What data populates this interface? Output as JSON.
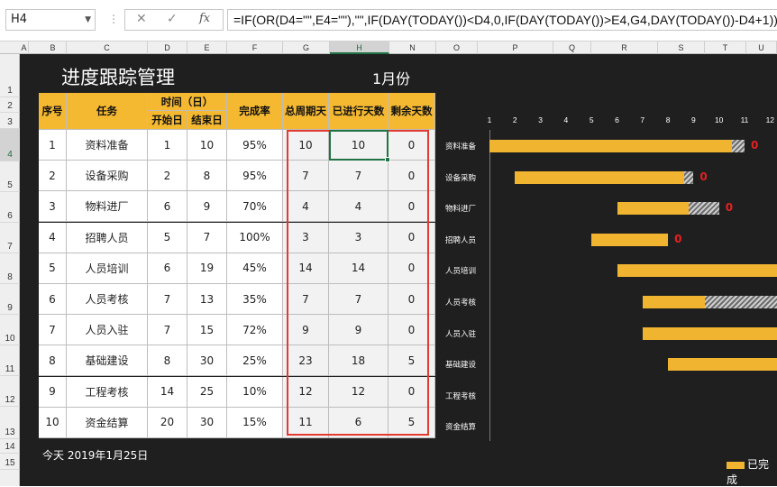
{
  "formula_bar": {
    "cell_ref": "H4",
    "cancel_symbol": "✕",
    "enter_symbol": "✓",
    "fx_label": "fx",
    "formula": "=IF(OR(D4=\"\",E4=\"\"),\"\",IF(DAY(TODAY())<D4,0,IF(DAY(TODAY())>E4,G4,DAY(TODAY())-D4+1)))"
  },
  "columns": [
    "A",
    "B",
    "C",
    "D",
    "E",
    "F",
    "G",
    "H",
    "N",
    "O",
    "P",
    "Q",
    "R",
    "S",
    "T",
    "U"
  ],
  "rows": [
    "1",
    "2",
    "3",
    "4",
    "5",
    "6",
    "7",
    "8",
    "9",
    "10",
    "11",
    "12",
    "13",
    "14",
    "15"
  ],
  "sheet": {
    "title": "进度跟踪管理",
    "month": "1月份",
    "today_text": "今天  2019年1月25日"
  },
  "table": {
    "headers": {
      "seq": "序号",
      "task": "任务",
      "time_group": "时间（日）",
      "start": "开始日",
      "end": "结束日",
      "completion": "完成率",
      "total_days": "总周期天",
      "elapsed_days": "已进行天数",
      "remaining_days": "剩余天数"
    },
    "rows": [
      {
        "seq": "1",
        "task": "资料准备",
        "start": "1",
        "end": "10",
        "rate": "95%",
        "total": "10",
        "elapsed": "10",
        "remain": "0"
      },
      {
        "seq": "2",
        "task": "设备采购",
        "start": "2",
        "end": "8",
        "rate": "95%",
        "total": "7",
        "elapsed": "7",
        "remain": "0"
      },
      {
        "seq": "3",
        "task": "物料进厂",
        "start": "6",
        "end": "9",
        "rate": "70%",
        "total": "4",
        "elapsed": "4",
        "remain": "0"
      },
      {
        "seq": "4",
        "task": "招聘人员",
        "start": "5",
        "end": "7",
        "rate": "100%",
        "total": "3",
        "elapsed": "3",
        "remain": "0"
      },
      {
        "seq": "5",
        "task": "人员培训",
        "start": "6",
        "end": "19",
        "rate": "45%",
        "total": "14",
        "elapsed": "14",
        "remain": "0"
      },
      {
        "seq": "6",
        "task": "人员考核",
        "start": "7",
        "end": "13",
        "rate": "35%",
        "total": "7",
        "elapsed": "7",
        "remain": "0"
      },
      {
        "seq": "7",
        "task": "人员入驻",
        "start": "7",
        "end": "15",
        "rate": "72%",
        "total": "9",
        "elapsed": "9",
        "remain": "0"
      },
      {
        "seq": "8",
        "task": "基础建设",
        "start": "8",
        "end": "30",
        "rate": "25%",
        "total": "23",
        "elapsed": "18",
        "remain": "5"
      },
      {
        "seq": "9",
        "task": "工程考核",
        "start": "14",
        "end": "25",
        "rate": "10%",
        "total": "12",
        "elapsed": "12",
        "remain": "0"
      },
      {
        "seq": "10",
        "task": "资金结算",
        "start": "20",
        "end": "30",
        "rate": "15%",
        "total": "11",
        "elapsed": "6",
        "remain": "5"
      }
    ]
  },
  "gantt": {
    "ticks": [
      "1",
      "2",
      "3",
      "4",
      "5",
      "6",
      "7",
      "8",
      "9",
      "10",
      "11",
      "12"
    ],
    "labels": [
      "资料准备",
      "设备采购",
      "物料进厂",
      "招聘人员",
      "人员培训",
      "人员考核",
      "人员入驻",
      "基础建设",
      "工程考核",
      "资金结算"
    ],
    "zero_label": "0",
    "legend_text": "已完成",
    "bar_color": "#f0b431"
  }
}
